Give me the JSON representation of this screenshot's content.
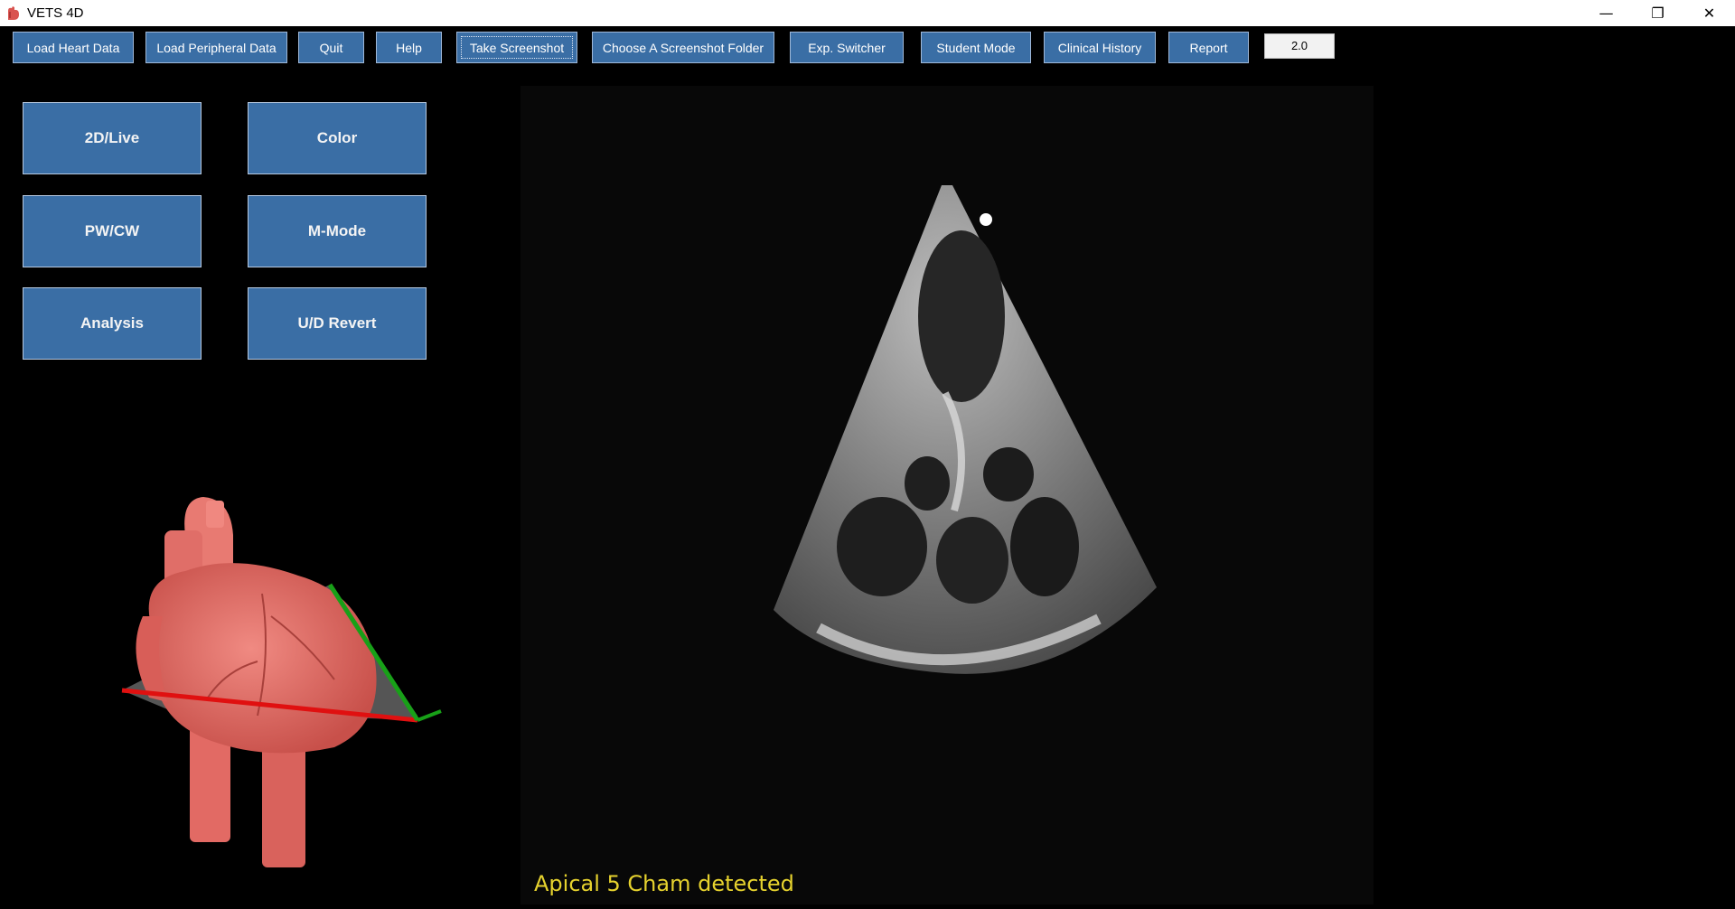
{
  "window": {
    "title": "VETS 4D",
    "icon": "heart-app-icon",
    "controls": {
      "minimize": "—",
      "restore": "❐",
      "close": "✕"
    }
  },
  "toolbar": {
    "load_heart": "Load Heart Data",
    "load_peripheral": "Load Peripheral Data",
    "quit": "Quit",
    "help": "Help",
    "take_screenshot": "Take Screenshot",
    "choose_folder": "Choose A Screenshot Folder",
    "exp_switcher": "Exp. Switcher",
    "student_mode": "Student Mode",
    "clinical_history": "Clinical History",
    "report": "Report",
    "speed_value": "2.0"
  },
  "modes": {
    "live2d": "2D/Live",
    "color": "Color",
    "pwcw": "PW/CW",
    "mmode": "M-Mode",
    "analysis": "Analysis",
    "ud_revert": "U/D Revert"
  },
  "status": {
    "detected": "Apical 5 Cham detected",
    "color": "#e6d22e"
  },
  "colors": {
    "button_bg": "#3a6ea5",
    "heart": "#e8706a",
    "axis_red": "#e01010",
    "axis_green": "#18a018"
  }
}
